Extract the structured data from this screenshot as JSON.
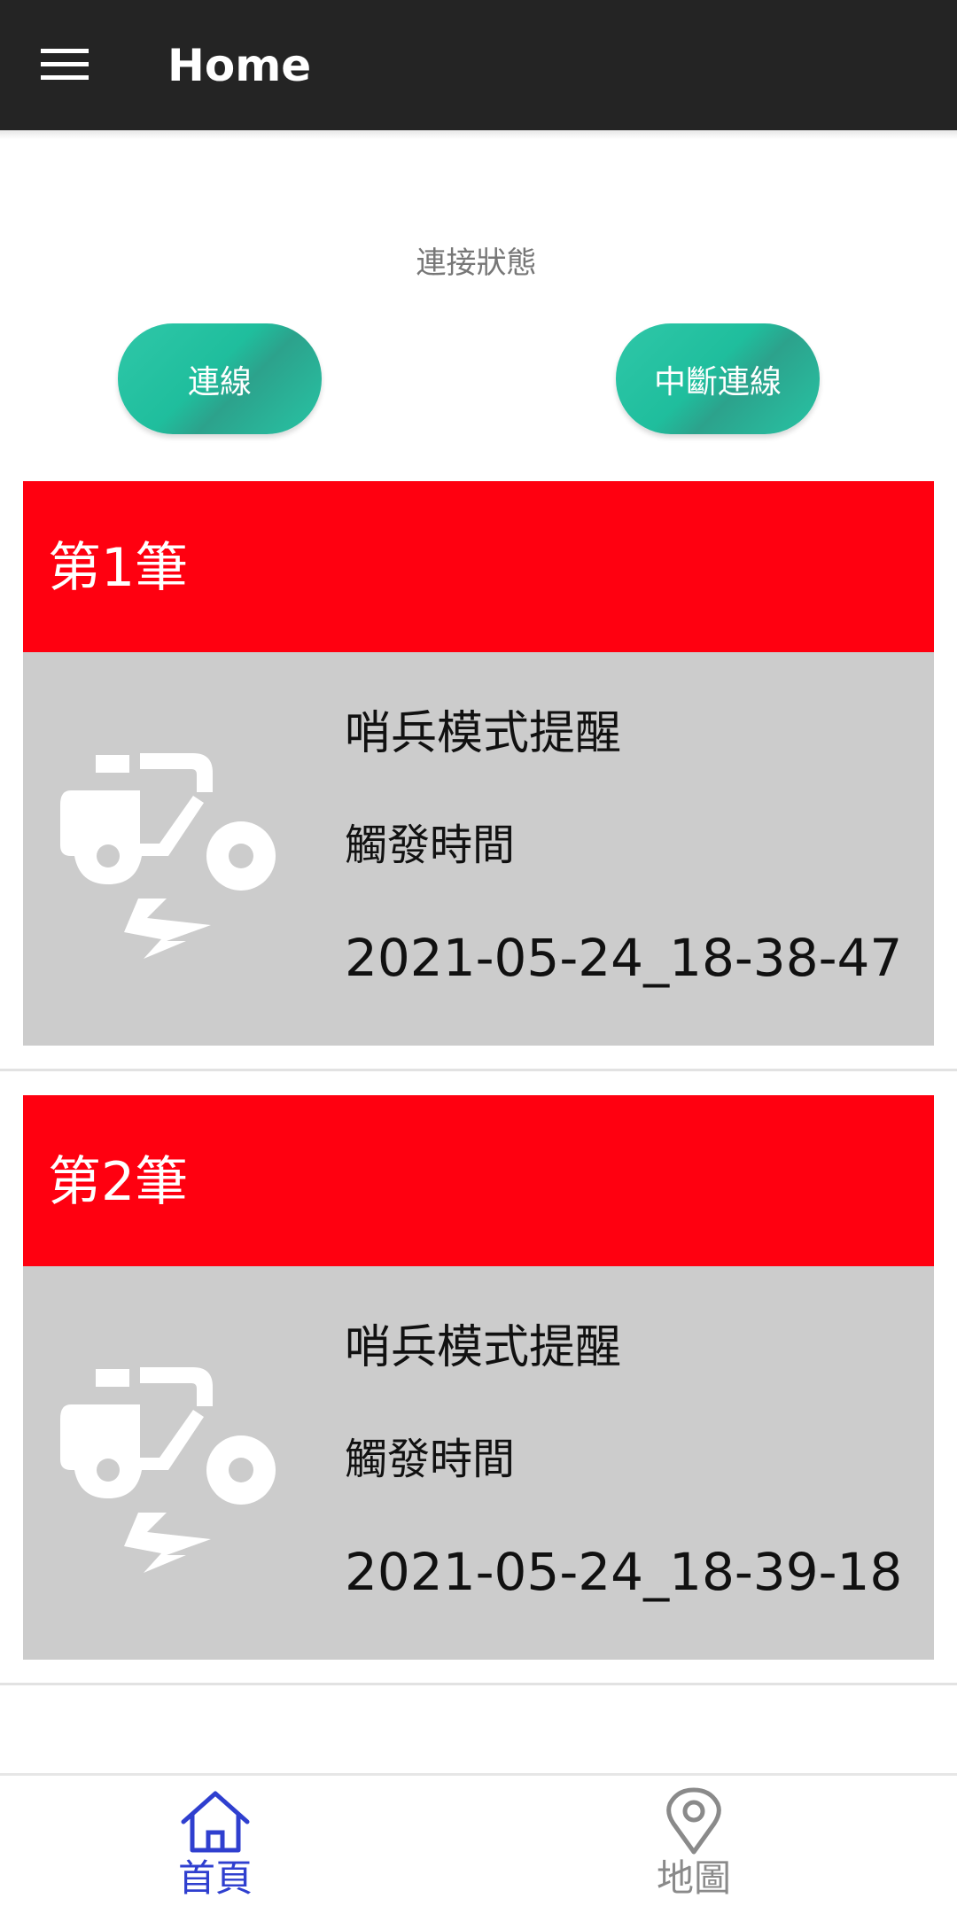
{
  "appbar": {
    "title": "Home",
    "menu_icon": "hamburger-menu-icon"
  },
  "connection": {
    "status_label": "連接狀態",
    "connect_label": "連線",
    "disconnect_label": "中斷連線",
    "button_color": "#1fbe9d"
  },
  "alerts": [
    {
      "title": "第1筆",
      "type": "哨兵模式提醒",
      "trigger_label": "觸發時間",
      "timestamp": "2021-05-24_18-38-47",
      "icon": "scooter-alert-icon"
    },
    {
      "title": "第2筆",
      "type": "哨兵模式提醒",
      "trigger_label": "觸發時間",
      "timestamp": "2021-05-24_18-39-18",
      "icon": "scooter-alert-icon"
    }
  ],
  "nav": {
    "home_label": "首頁",
    "map_label": "地圖",
    "active_color": "#2f3fcf",
    "inactive_color": "#8a8a8a"
  },
  "colors": {
    "appbar": "#242424",
    "card_header": "#ff0010",
    "card_body": "#cccccc"
  }
}
